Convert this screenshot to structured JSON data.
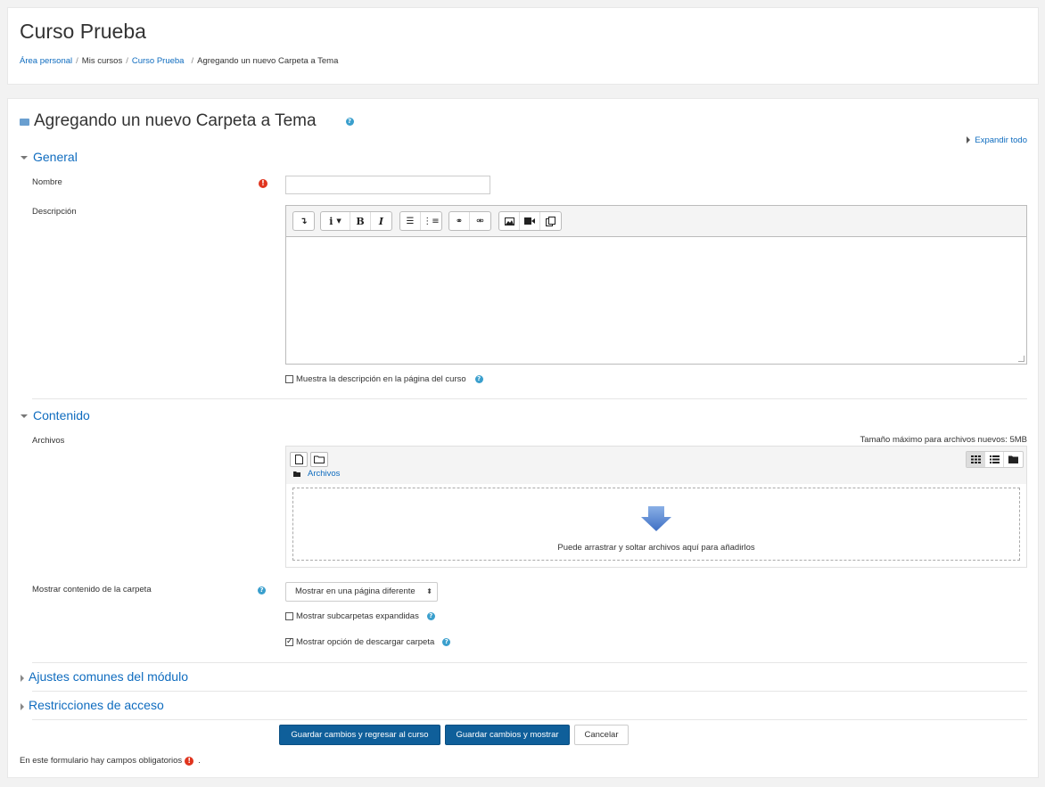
{
  "header": {
    "course_title": "Curso Prueba",
    "breadcrumb": [
      {
        "label": "Área personal"
      },
      {
        "label": "Mis cursos"
      },
      {
        "label": "Curso Prueba"
      },
      {
        "label": "Agregando un nuevo Carpeta a Tema"
      }
    ]
  },
  "form": {
    "heading": "Agregando un nuevo Carpeta a Tema",
    "expand_all": "Expandir todo",
    "sections": {
      "general": "General",
      "contenido": "Contenido",
      "ajustes": "Ajustes comunes del módulo",
      "restricciones": "Restricciones de acceso"
    },
    "nombre": {
      "label": "Nombre",
      "value": ""
    },
    "descripcion": {
      "label": "Descripción",
      "value": ""
    },
    "show_description": {
      "label": "Muestra la descripción en la página del curso",
      "checked": false
    },
    "archivos": {
      "label": "Archivos",
      "max_size": "Tamaño máximo para archivos nuevos: 5MB",
      "path": "Archivos",
      "drop_text": "Puede arrastrar y soltar archivos aquí para añadirlos"
    },
    "mostrar_contenido": {
      "label": "Mostrar contenido de la carpeta",
      "selected": "Mostrar en una página diferente"
    },
    "subcarpetas": {
      "label": "Mostrar subcarpetas expandidas",
      "checked": false
    },
    "descargar": {
      "label": "Mostrar opción de descargar carpeta",
      "checked": true
    },
    "buttons": {
      "save_return": "Guardar cambios y regresar al curso",
      "save_display": "Guardar cambios y mostrar",
      "cancel": "Cancelar"
    },
    "required_note": "En este formulario hay campos obligatorios",
    "required_note_suffix": "."
  },
  "colors": {
    "accent": "#0f6cbf",
    "primary_button": "#0f5f9a",
    "required": "#e0341e",
    "help": "#3a9fcd"
  }
}
